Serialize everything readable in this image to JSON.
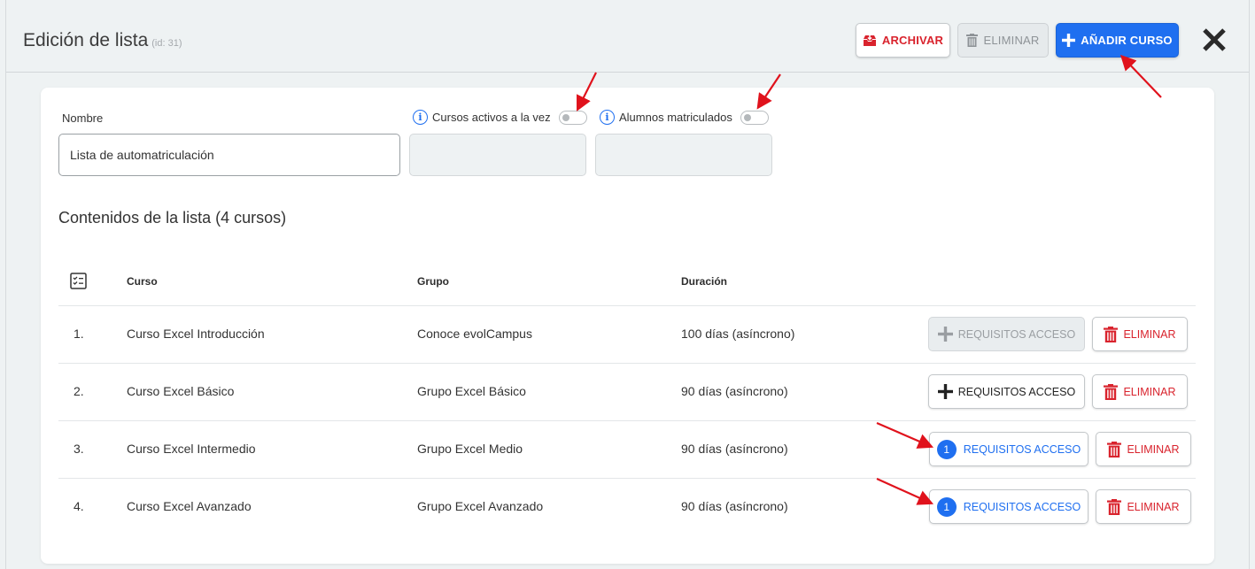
{
  "header": {
    "title": "Edición de lista",
    "id_label": "(id: 31)",
    "archive_label": "ARCHIVAR",
    "delete_label": "ELIMINAR",
    "add_course_label": "AÑADIR CURSO"
  },
  "form": {
    "name_label": "Nombre",
    "name_value": "Lista de automatriculación",
    "active_courses_label": "Cursos activos a la vez",
    "enrolled_label": "Alumnos matriculados"
  },
  "list": {
    "title": "Contenidos de la lista (4 cursos)",
    "columns": {
      "course": "Curso",
      "group": "Grupo",
      "duration": "Duración"
    },
    "rows": [
      {
        "num": "1.",
        "course": "Curso Excel Introducción",
        "group": "Conoce evolCampus",
        "duration": "100 días (asíncrono)",
        "req_label": "REQUISITOS ACCESO",
        "del_label": "ELIMINAR"
      },
      {
        "num": "2.",
        "course": "Curso Excel Básico",
        "group": "Grupo Excel Básico",
        "duration": "90 días (asíncrono)",
        "req_label": "REQUISITOS ACCESO",
        "del_label": "ELIMINAR"
      },
      {
        "num": "3.",
        "course": "Curso Excel Intermedio",
        "group": "Grupo Excel Medio",
        "duration": "90 días (asíncrono)",
        "req_label": "REQUISITOS ACCESO",
        "req_count": "1",
        "del_label": "ELIMINAR"
      },
      {
        "num": "4.",
        "course": "Curso Excel Avanzado",
        "group": "Grupo Excel Avanzado",
        "duration": "90 días (asíncrono)",
        "req_label": "REQUISITOS ACCESO",
        "req_count": "1",
        "del_label": "ELIMINAR"
      }
    ]
  },
  "colors": {
    "primary": "#1f6ff0",
    "danger": "#d9232d",
    "annotation_arrow": "#e0121c"
  }
}
